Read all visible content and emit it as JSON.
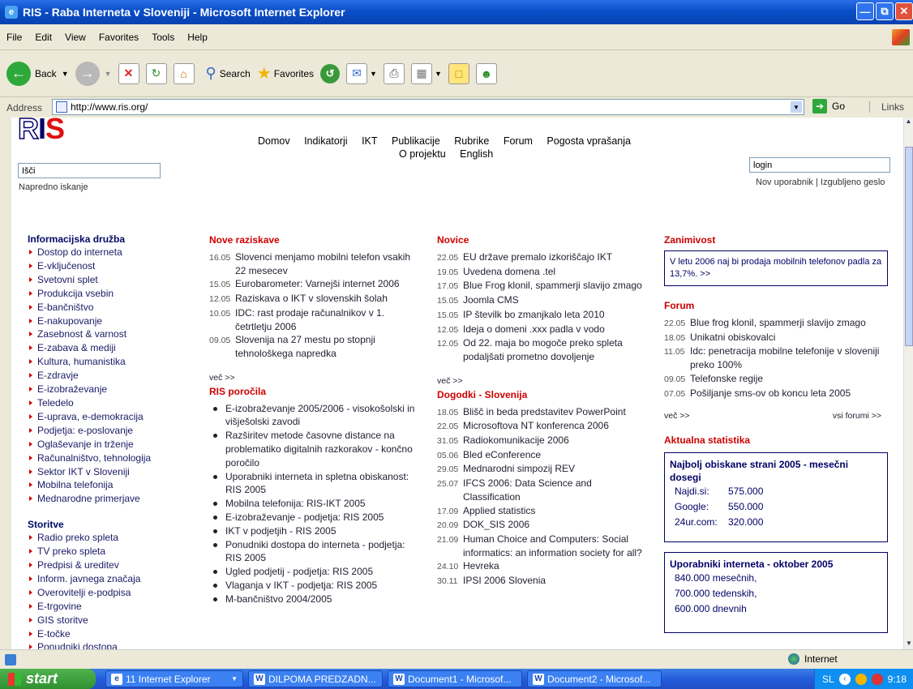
{
  "window": {
    "title": "RIS - Raba Interneta v Sloveniji - Microsoft Internet Explorer"
  },
  "menu": [
    "File",
    "Edit",
    "View",
    "Favorites",
    "Tools",
    "Help"
  ],
  "toolbar": {
    "back": "Back",
    "search": "Search",
    "favorites": "Favorites"
  },
  "address": {
    "label": "Address",
    "url": "http://www.ris.org/",
    "go": "Go",
    "links": "Links"
  },
  "site": {
    "logo": "RIS",
    "nav": {
      "row1": [
        "Domov",
        "Indikatorji",
        "IKT",
        "Publikacije",
        "Rubrike",
        "Forum",
        "Pogosta vprašanja"
      ],
      "row2": [
        "O projektu",
        "English"
      ]
    },
    "search": {
      "value": "Išči",
      "advanced": "Napredno iskanje"
    },
    "login": {
      "value": "login",
      "new_user": "Nov uporabnik",
      "separator": "|",
      "forgot": "Izgubljeno geslo"
    },
    "sidebar": {
      "section1": {
        "title": "Informacijska družba",
        "items": [
          "Dostop do interneta",
          "E-vključenost",
          "Svetovni splet",
          "Produkcija vsebin",
          "E-bančništvo",
          "E-nakupovanje",
          "Zasebnost & varnost",
          "E-zabava & mediji",
          "Kultura, humanistika",
          "E-zdravje",
          "E-izobraževanje",
          "Teledelo",
          "E-uprava, e-demokracija",
          "Podjetja: e-poslovanje",
          "Oglaševanje in trženje",
          "Računalništvo, tehnologija",
          "Sektor IKT v Sloveniji",
          "Mobilna telefonija",
          "Mednarodne primerjave"
        ]
      },
      "section2": {
        "title": "Storitve",
        "items": [
          "Radio preko spleta",
          "TV preko spleta",
          "Predpisi & ureditev",
          "Inform. javnega značaja",
          "Overovitelji e-podpisa",
          "E-trgovine",
          "GIS storitve",
          "E-točke",
          "Ponudniki dostopa"
        ]
      }
    },
    "nove_raziskave": {
      "title": "Nove raziskave",
      "items": [
        {
          "date": "16.05",
          "text": "Slovenci menjamo mobilni telefon vsakih 22 mesecev"
        },
        {
          "date": "15.05",
          "text": "Eurobarometer: Varnejši internet 2006"
        },
        {
          "date": "12.05",
          "text": "Raziskava o IKT v slovenskih šolah"
        },
        {
          "date": "10.05",
          "text": "IDC: rast prodaje računalnikov v 1. četrtletju 2006"
        },
        {
          "date": "09.05",
          "text": "Slovenija na 27 mestu po stopnji tehnološkega napredka"
        }
      ],
      "more": "več >>"
    },
    "ris_porocila": {
      "title": "RIS poročila",
      "items": [
        "E-izobraževanje 2005/2006 - visokošolski in višješolski zavodi",
        "Razširitev metode časovne distance na problematiko digitalnih razkorakov - končno poročilo",
        "Uporabniki interneta in spletna obiskanost: RIS 2005",
        "Mobilna telefonija: RIS-IKT 2005",
        "E-izobraževanje - podjetja: RIS 2005",
        "IKT v podjetjih - RIS 2005",
        "Ponudniki dostopa do interneta - podjetja: RIS 2005",
        "Ugled podjetij - podjetja: RIS 2005",
        "Vlaganja v IKT - podjetja: RIS 2005",
        "M-bančništvo 2004/2005"
      ]
    },
    "novice": {
      "title": "Novice",
      "items": [
        {
          "date": "22.05",
          "text": "EU države premalo izkoriščajo IKT"
        },
        {
          "date": "19.05",
          "text": "Uvedena domena .tel"
        },
        {
          "date": "17.05",
          "text": "Blue Frog klonil, spammerji slavijo zmago"
        },
        {
          "date": "15.05",
          "text": "Joomla CMS"
        },
        {
          "date": "15.05",
          "text": "IP številk bo zmanjkalo leta 2010"
        },
        {
          "date": "12.05",
          "text": "Ideja o domeni .xxx padla v vodo"
        },
        {
          "date": "12.05",
          "text": "Od 22. maja bo mogoče preko spleta podaljšati prometno dovoljenje"
        }
      ],
      "more": "več >>"
    },
    "dogodki": {
      "title": "Dogodki - Slovenija",
      "items": [
        {
          "date": "18.05",
          "text": "Blišč in beda predstavitev PowerPoint"
        },
        {
          "date": "22.05",
          "text": "Microsoftova NT konferenca 2006"
        },
        {
          "date": "31.05",
          "text": "Radiokomunikacije 2006"
        },
        {
          "date": "05.06",
          "text": "Bled eConference"
        },
        {
          "date": "29.05",
          "text": "Mednarodni simpozij REV"
        },
        {
          "date": "25.07",
          "text": "IFCS 2006: Data Science and Classification"
        },
        {
          "date": "17.09",
          "text": "Applied statistics"
        },
        {
          "date": "20.09",
          "text": "DOK_SIS 2006"
        },
        {
          "date": "21.09",
          "text": "Human Choice and Computers: Social informatics: an information society for all?"
        },
        {
          "date": "24.10",
          "text": "Hevreka"
        },
        {
          "date": "30.11",
          "text": "IPSI 2006 Slovenia"
        }
      ]
    },
    "zanimivost": {
      "title": "Zanimivost",
      "text": "V letu 2006 naj bi prodaja mobilnih telefonov padla za 13,7%. >>"
    },
    "forum": {
      "title": "Forum",
      "items": [
        {
          "date": "22.05",
          "text": "Blue frog klonil, spammerji slavijo zmago"
        },
        {
          "date": "18.05",
          "text": "Unikatni obiskovalci"
        },
        {
          "date": "11.05",
          "text": "Idc: penetracija mobilne telefonije v sloveniji preko 100%"
        },
        {
          "date": "09.05",
          "text": "Telefonske regije"
        },
        {
          "date": "07.05",
          "text": "Pošiljanje sms-ov ob koncu leta 2005"
        }
      ],
      "more": "več >>",
      "all": "vsi forumi >>"
    },
    "statistika": {
      "title": "Aktualna statistika",
      "box1": {
        "title": "Najbolj obiskane strani 2005 - mesečni dosegi",
        "rows": [
          {
            "site": "Najdi.si:",
            "value": "575.000"
          },
          {
            "site": "Google:",
            "value": "550.000"
          },
          {
            "site": "24ur.com:",
            "value": "320.000"
          }
        ]
      },
      "box2": {
        "title": "Uporabniki interneta - oktober 2005",
        "rows": [
          "840.000 mesečnih,",
          "700.000 tedenskih,",
          "600.000 dnevnih"
        ]
      }
    }
  },
  "status": {
    "zone": "Internet"
  },
  "taskbar": {
    "start": "start",
    "tasks": [
      "11 Internet Explorer",
      "DILPOMA PREDZADN...",
      "Document1 - Microsof...",
      "Document2 - Microsof..."
    ],
    "lang": "SL",
    "time": "9:18"
  }
}
